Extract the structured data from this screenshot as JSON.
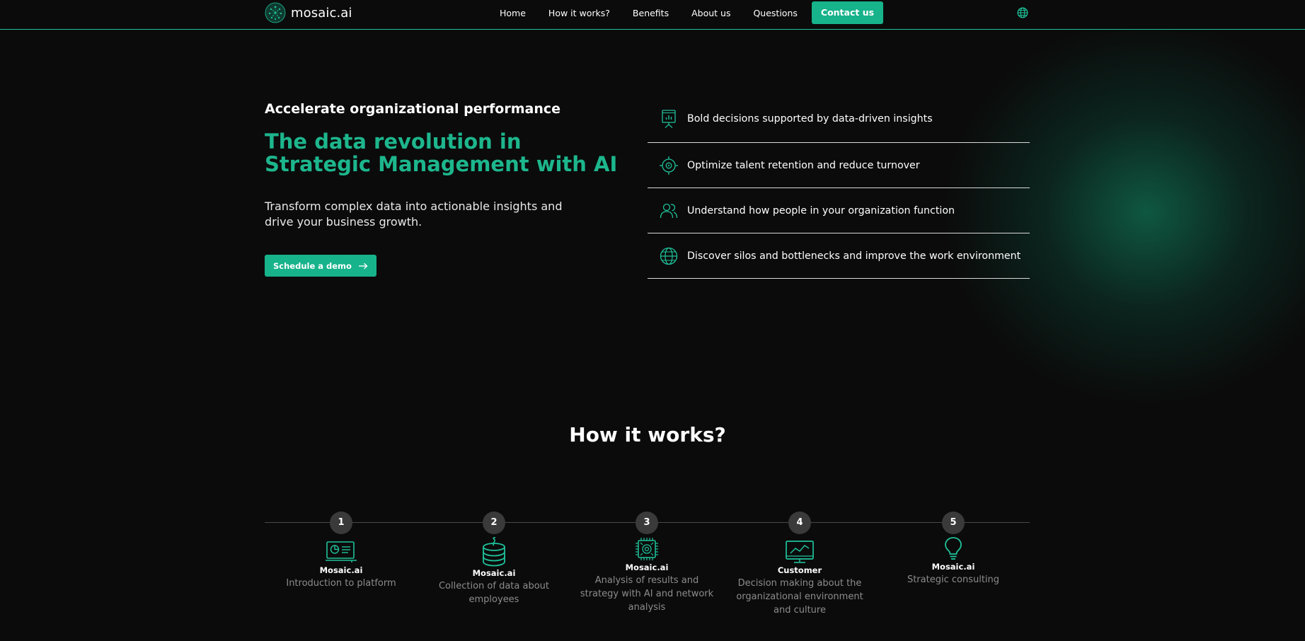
{
  "nav": {
    "logo_text": "mosaic.ai",
    "items": [
      "Home",
      "How it works?",
      "Benefits",
      "About us",
      "Questions"
    ],
    "contact_label": "Contact us",
    "language_icon": "globe-icon"
  },
  "hero": {
    "eyebrow": "Accelerate organizational performance",
    "headline": "The data revolution in Strategic Management with AI",
    "description": "Transform complex data into actionable insights and drive your business growth.",
    "cta_label": "Schedule a demo",
    "cta_icon": "arrow-right-icon"
  },
  "features": [
    {
      "icon": "presentation-chart-icon",
      "text": "Bold decisions supported by data-driven insights"
    },
    {
      "icon": "target-icon",
      "text": "Optimize talent retention and reduce turnover"
    },
    {
      "icon": "users-icon",
      "text": "Understand how people in your organization function"
    },
    {
      "icon": "globe-icon",
      "text": "Discover silos and bottlenecks and improve the work environment"
    }
  ],
  "how_it_works": {
    "title": "How it works?",
    "steps": [
      {
        "number": "1",
        "icon": "monitor-dashboard-icon",
        "actor": "Mosaic.ai",
        "description": "Introduction to platform"
      },
      {
        "number": "2",
        "icon": "database-icon",
        "actor": "Mosaic.ai",
        "description": "Collection of data about employees"
      },
      {
        "number": "3",
        "icon": "ai-chip-icon",
        "actor": "Mosaic.ai",
        "description": "Analysis of results and strategy with AI and network analysis"
      },
      {
        "number": "4",
        "icon": "monitor-chart-icon",
        "actor": "Customer",
        "description": "Decision making about the organizational environment and culture"
      },
      {
        "number": "5",
        "icon": "lightbulb-icon",
        "actor": "Mosaic.ai",
        "description": "Strategic consulting"
      }
    ]
  },
  "colors": {
    "accent": "#17b38b",
    "headline": "#1db68d",
    "background": "#0b0b0b",
    "step_circle": "#3a3a3a",
    "muted_text": "#8c8c8c"
  }
}
